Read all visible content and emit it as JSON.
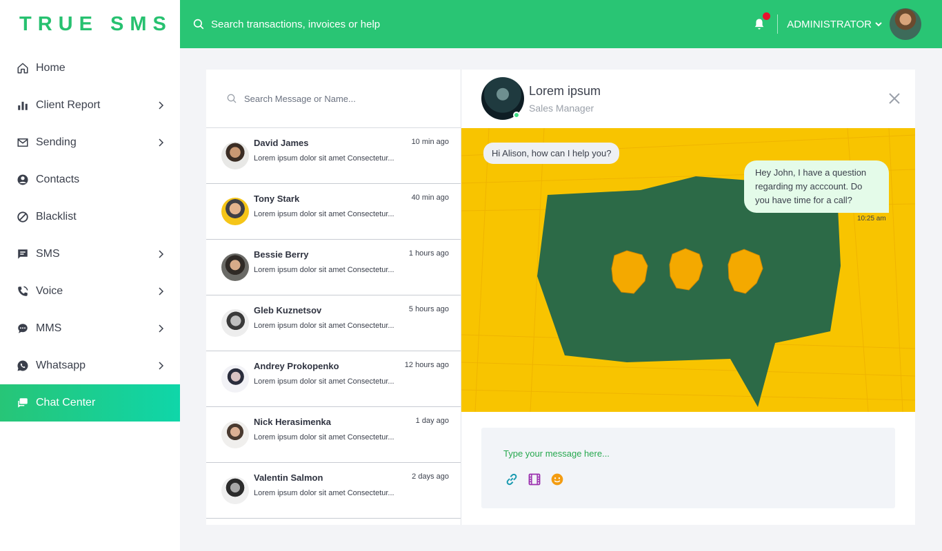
{
  "brand": "TRUE SMS",
  "top": {
    "search_text": "Search transactions, invoices or help",
    "user_label": "ADMINISTRATOR"
  },
  "sidebar": {
    "items": [
      {
        "label": "Home",
        "icon": "home-icon"
      },
      {
        "label": "Client Report",
        "icon": "bar-chart-icon"
      },
      {
        "label": "Sending",
        "icon": "mail-icon"
      },
      {
        "label": "Contacts",
        "icon": "user-circle-icon"
      },
      {
        "label": "Blacklist",
        "icon": "block-icon"
      },
      {
        "label": "SMS",
        "icon": "message-icon"
      },
      {
        "label": "Voice",
        "icon": "phone-icon"
      },
      {
        "label": "MMS",
        "icon": "chat-bubble-icon"
      },
      {
        "label": "Whatsapp",
        "icon": "whatsapp-icon"
      },
      {
        "label": "Chat Center",
        "icon": "chat-center-icon"
      }
    ]
  },
  "chat_list": {
    "search_placeholder": "Search Message or Name...",
    "contacts": [
      {
        "name": "David James",
        "time": "10 min ago",
        "preview": "Lorem ipsum dolor sit amet Consectetur..."
      },
      {
        "name": "Tony Stark",
        "time": "40 min ago",
        "preview": "Lorem ipsum dolor sit amet Consectetur..."
      },
      {
        "name": "Bessie Berry",
        "time": "1 hours ago",
        "preview": "Lorem ipsum dolor sit amet Consectetur..."
      },
      {
        "name": "Gleb Kuznetsov",
        "time": "5 hours ago",
        "preview": "Lorem ipsum dolor sit amet Consectetur..."
      },
      {
        "name": "Andrey Prokopenko",
        "time": "12 hours ago",
        "preview": "Lorem ipsum dolor sit amet Consectetur..."
      },
      {
        "name": "Nick Herasimenka",
        "time": "1 day ago",
        "preview": "Lorem ipsum dolor sit amet Consectetur..."
      },
      {
        "name": "Valentin Salmon",
        "time": "2 days ago",
        "preview": "Lorem ipsum dolor sit amet Consectetur..."
      }
    ]
  },
  "chat": {
    "name": "Lorem ipsum",
    "role": "Sales Manager",
    "incoming": "Hi Alison, how can I help you?",
    "outgoing": "Hey John, I have a question regarding my acccount. Do you have time for a call?",
    "outgoing_time": "10:25 am",
    "composer_placeholder": "Type your message here..."
  },
  "colors": {
    "brand_green": "#29c574",
    "active_gradient_start": "#27c577",
    "active_gradient_end": "#0fd6a9",
    "notification_dot": "#e8112d",
    "attach_icon": "#1a9ab0",
    "video_icon": "#9b2fae",
    "emoji_icon": "#f39c12"
  }
}
